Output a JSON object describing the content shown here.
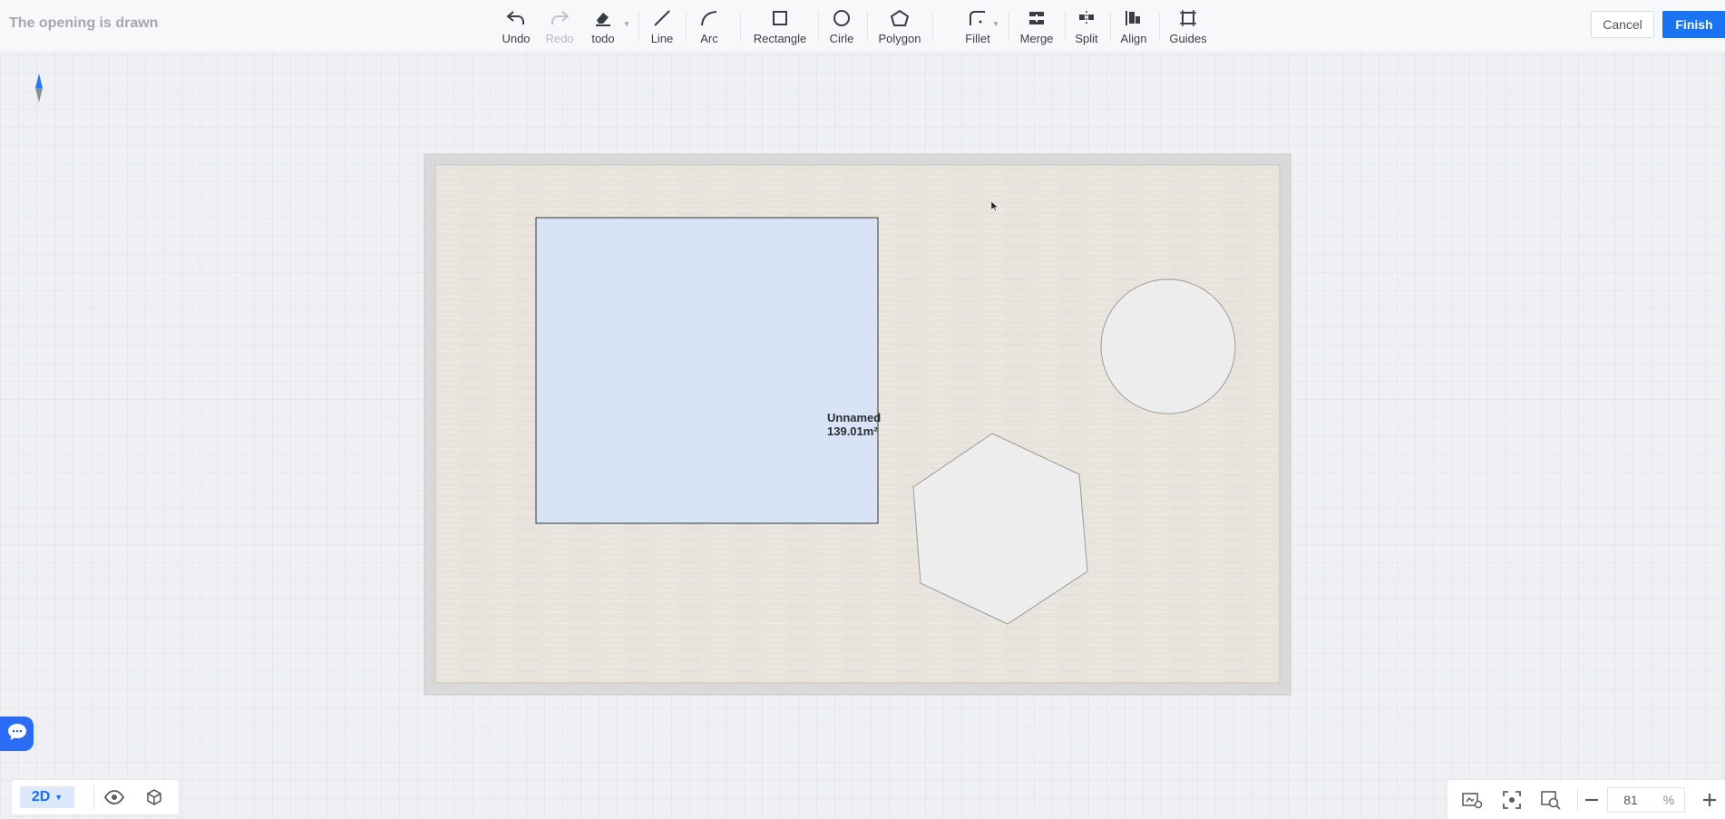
{
  "header": {
    "title": "The opening is drawn",
    "tools": [
      {
        "label": "Undo",
        "icon": "undo-icon"
      },
      {
        "label": "Redo",
        "icon": "redo-icon"
      },
      {
        "label": "todo",
        "icon": "eraser-icon"
      },
      {
        "label": "Line",
        "icon": "line-icon"
      },
      {
        "label": "Arc",
        "icon": "arc-icon"
      },
      {
        "label": "Rectangle",
        "icon": "rectangle-icon"
      },
      {
        "label": "Cirle",
        "icon": "circle-icon"
      },
      {
        "label": "Polygon",
        "icon": "polygon-icon"
      },
      {
        "label": "Fillet",
        "icon": "fillet-icon"
      },
      {
        "label": "Merge",
        "icon": "merge-icon"
      },
      {
        "label": "Split",
        "icon": "split-icon"
      },
      {
        "label": "Align",
        "icon": "align-icon"
      },
      {
        "label": "Guides",
        "icon": "guides-icon"
      }
    ],
    "cancel_label": "Cancel",
    "finish_label": "Finish"
  },
  "canvas": {
    "room": {
      "name": "Unnamed",
      "area": "139.01m²"
    }
  },
  "bottom_left": {
    "view_mode": "2D",
    "icons": [
      "eye-icon",
      "cube-icon"
    ]
  },
  "bottom_right": {
    "icons": [
      "view-settings-icon",
      "fit-view-icon",
      "zoom-search-icon",
      "zoom-out-icon",
      "zoom-in-icon"
    ],
    "zoom_value": "81",
    "zoom_unit": "%"
  },
  "colors": {
    "accent": "#1a73f0",
    "selected_area": "#d8e4f5",
    "floor": "#e8e3dc",
    "wall": "#d9d9d9"
  }
}
